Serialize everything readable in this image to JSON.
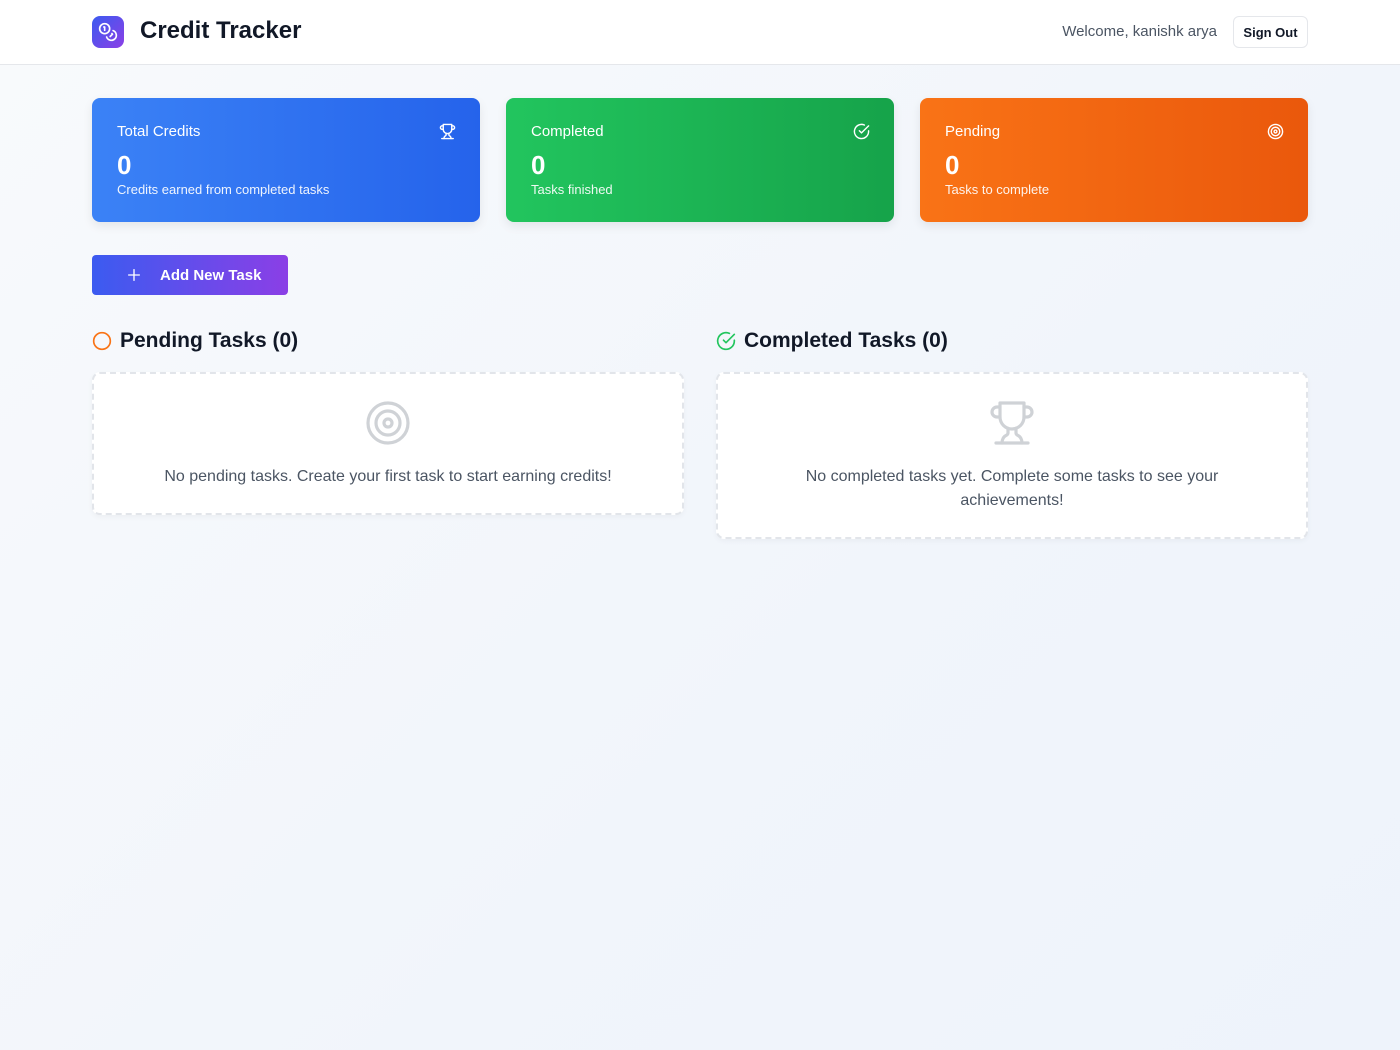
{
  "header": {
    "app_title": "Credit Tracker",
    "welcome": "Welcome, kanishk arya",
    "sign_out": "Sign Out",
    "logo_icon": "coins-icon"
  },
  "stats": [
    {
      "label": "Total Credits",
      "value": "0",
      "sub": "Credits earned from completed tasks",
      "icon": "trophy-icon",
      "color": "#3b82f6"
    },
    {
      "label": "Completed",
      "value": "0",
      "sub": "Tasks finished",
      "icon": "check-circle-icon",
      "color": "#22c55e"
    },
    {
      "label": "Pending",
      "value": "0",
      "sub": "Tasks to complete",
      "icon": "target-icon",
      "color": "#f97316"
    }
  ],
  "actions": {
    "add_task": "Add New Task"
  },
  "pending": {
    "title": "Pending Tasks (0)",
    "empty_text": "No pending tasks. Create your first task to start earning credits!",
    "color": "#f97316"
  },
  "completed": {
    "title": "Completed Tasks (0)",
    "empty_text": "No completed tasks yet. Complete some tasks to see your achievements!",
    "color": "#22c55e"
  }
}
